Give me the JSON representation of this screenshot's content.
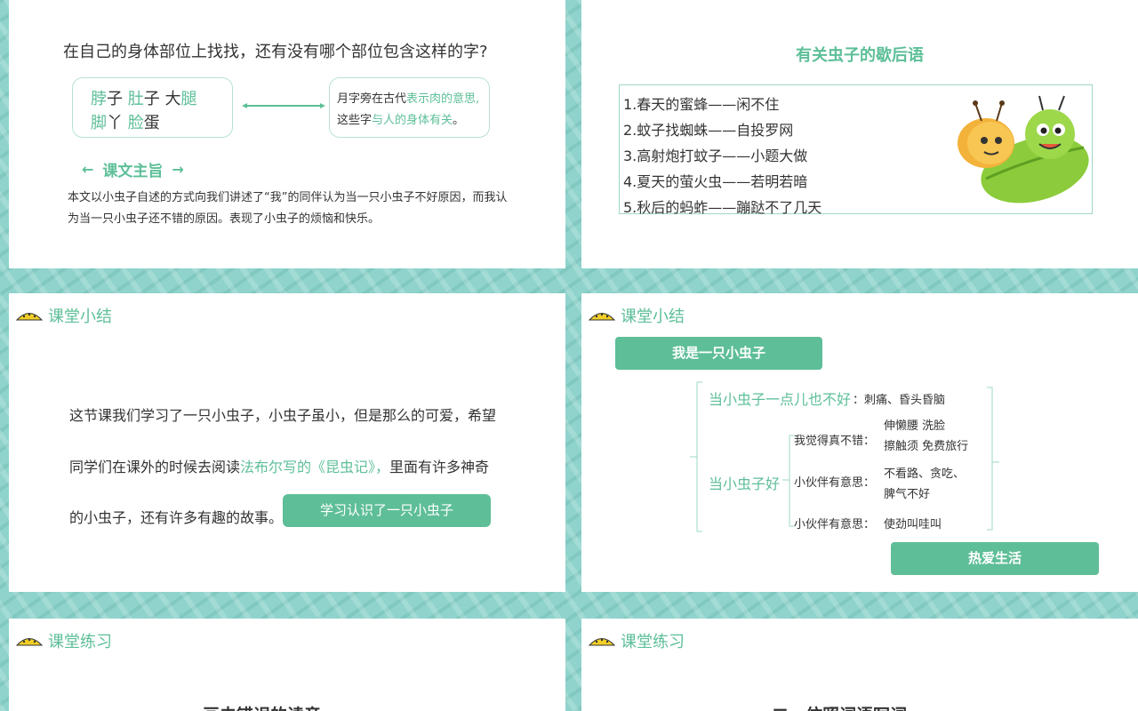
{
  "slide1": {
    "question": "在自己的身体部位上找找，还有没有哪个部位包含这样的字?",
    "chars_line1": [
      {
        "g": "脖",
        "t": "子"
      },
      {
        "g": "肚",
        "t": "子"
      },
      {
        "t": "大",
        "g": "腿"
      }
    ],
    "line1_text": {
      "a": "脖",
      "b": "子  ",
      "c": "肚",
      "d": "子  ",
      "e": "大",
      "f": "腿"
    },
    "line2_text": {
      "a": "脚",
      "b": "丫  ",
      "c": "脸",
      "d": "蛋"
    },
    "note": {
      "p1": "月字旁在古代",
      "p2": "表示肉的意思,",
      "p3": "这些字",
      "p4": "与人的身体有关",
      "p5": "。"
    },
    "theme_title": "课文主旨",
    "theme_text": "本文以小虫子自述的方式向我们讲述了“我”的同伴认为当一只小虫子不好原因，而我认为当一只小虫子还不错的原因。表现了小虫子的烦恼和快乐。"
  },
  "slide2": {
    "title": "有关虫子的歇后语",
    "items": [
      "1.春天的蜜蜂——闲不住",
      "2.蚊子找蜘蛛——自投罗网",
      "3.高射炮打蚊子——小题大做",
      "4.夏天的萤火虫——若明若暗",
      "5.秋后的蚂蚱——蹦跶不了几天"
    ]
  },
  "slide3": {
    "section": "课堂小结",
    "line1": "这节课我们学习了一只小虫子，小虫子虽小，但是那么的可爱，希望",
    "line2a": "同学们在课外的时候去阅读",
    "line2b": "法布尔写的《昆虫记》，",
    "line2c": "里面有许多神奇",
    "line3": "的小虫子，还有许多有趣的故事。",
    "button": "学习认识了一只小虫子"
  },
  "slide4": {
    "section": "课堂小结",
    "main": "我是一只小虫子",
    "bad_label": "当小虫子一点儿也不好",
    "bad_value": "：刺痛、昏头昏脑",
    "good_label": "当小虫子好",
    "sub1_label": "我觉得真不错：",
    "sub1_v1": "伸懒腰 洗脸",
    "sub1_v2": "擦触须 免费旅行",
    "sub2_label": "小伙伴有意思：",
    "sub2_v1": "不看路、贪吃、",
    "sub2_v2": "脾气不好",
    "sub3_label": "小伙伴有意思：",
    "sub3_v1": "使劲叫哇叫",
    "end": "热爱生活"
  },
  "slide5": {
    "section": "课堂练习",
    "exercise": "一、画去错误的读音。"
  },
  "slide6": {
    "section": "课堂练习",
    "exercise": "二、仿照词语写词。"
  },
  "colors": {
    "accent": "#5dbf98",
    "button": "#5ebe98",
    "background": "#8fd3cc"
  },
  "icons": [
    "caterpillar-icon",
    "bug-icon",
    "double-arrow-icon"
  ]
}
